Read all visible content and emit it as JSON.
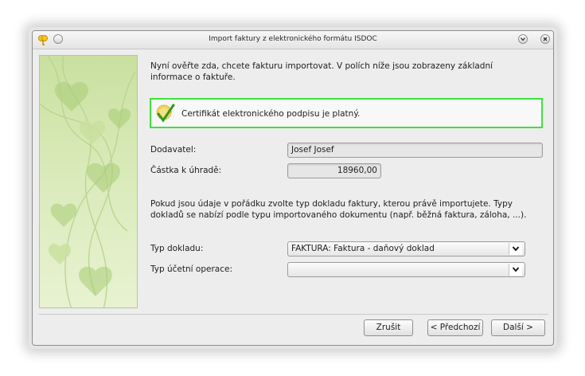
{
  "window": {
    "title": "Import faktury z elektronického formátu ISDOC"
  },
  "intro": {
    "text": "Nyní ověřte zda, chcete fakturu importovat. V polích níže jsou zobrazeny základní informace o faktuře."
  },
  "certificate": {
    "text": "Certifikát elektronického podpisu je platný.",
    "border_color": "#3ee23e"
  },
  "fields": {
    "supplier_label": "Dodavatel:",
    "supplier_value": "Josef Josef",
    "amount_label": "Částka k úhradě:",
    "amount_value": "18960,00"
  },
  "info": {
    "text": "Pokud jsou údaje v pořádku zvolte typ dokladu faktury, kterou právě importujete. Typy dokladů se nabízí podle typu importovaného dokumentu (např. běžná faktura, záloha, ...)."
  },
  "selects": {
    "doc_type_label": "Typ dokladu:",
    "doc_type_value": "FAKTURA: Faktura - daňový doklad",
    "op_type_label": "Typ účetní operace:",
    "op_type_value": ""
  },
  "buttons": {
    "cancel": "Zrušit",
    "back": "< Předchozí",
    "next": "Další >"
  },
  "icons": {
    "app": "key-shield-icon",
    "menu": "window-menu-icon",
    "minimize": "chevron-down-icon",
    "close": "close-icon",
    "certificate": "certificate-checkmark-icon",
    "dropdown": "chevron-down-icon"
  },
  "colors": {
    "accent_green": "#3ee23e",
    "side_panel": "#d9eab9"
  }
}
